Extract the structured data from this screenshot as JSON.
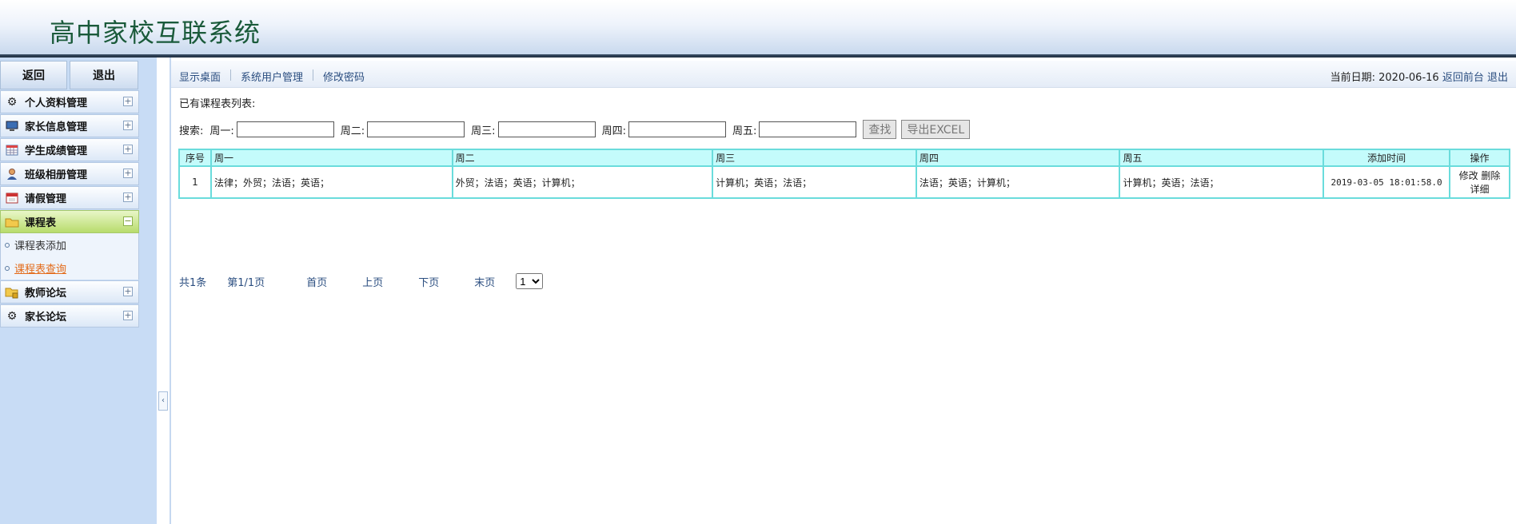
{
  "header": {
    "title": "高中家校互联系统"
  },
  "sidebar": {
    "back_label": "返回",
    "logout_label": "退出",
    "items": [
      {
        "label": "个人资料管理",
        "icon": "gear-icon",
        "toggle": "+"
      },
      {
        "label": "家长信息管理",
        "icon": "monitor-icon",
        "toggle": "+"
      },
      {
        "label": "学生成绩管理",
        "icon": "calendar-icon",
        "toggle": "+"
      },
      {
        "label": "班级相册管理",
        "icon": "user-icon",
        "toggle": "+"
      },
      {
        "label": "请假管理",
        "icon": "calendar-icon",
        "toggle": "+"
      },
      {
        "label": "课程表",
        "icon": "folder-icon",
        "toggle": "−"
      },
      {
        "label": "教师论坛",
        "icon": "folder-lock-icon",
        "toggle": "+"
      },
      {
        "label": "家长论坛",
        "icon": "gear-icon",
        "toggle": "+"
      }
    ],
    "sub_items": [
      {
        "label": "课程表添加"
      },
      {
        "label": "课程表查询"
      }
    ],
    "collapse_glyph": "‹"
  },
  "topnav": {
    "links": [
      "显示桌面",
      "系统用户管理",
      "修改密码"
    ],
    "date_label": "当前日期: ",
    "date_value": "2020-06-16",
    "back_front": "返回前台",
    "logout": "退出"
  },
  "main": {
    "list_title": "已有课程表列表:",
    "search": {
      "label": "搜索:",
      "fields": [
        {
          "label": "周一:",
          "value": ""
        },
        {
          "label": "周二:",
          "value": ""
        },
        {
          "label": "周三:",
          "value": ""
        },
        {
          "label": "周四:",
          "value": ""
        },
        {
          "label": "周五:",
          "value": ""
        }
      ],
      "find_button": "查找",
      "export_button": "导出EXCEL"
    },
    "table": {
      "headers": [
        "序号",
        "周一",
        "周二",
        "周三",
        "周四",
        "周五",
        "添加时间",
        "操作"
      ],
      "rows": [
        {
          "index": "1",
          "mon": "法律；外贸；法语；英语；",
          "tue": "外贸；法语；英语；计算机；",
          "wed": "计算机；英语；法语；",
          "thu": "法语；英语；计算机；",
          "fri": "计算机；英语；法语；",
          "time": "2019-03-05 18:01:58.0",
          "edit": "修改",
          "delete": "删除",
          "detail": "详细"
        }
      ]
    },
    "pager": {
      "total": "共1条",
      "page": "第1/1页",
      "first": "首页",
      "prev": "上页",
      "next": "下页",
      "last": "末页",
      "select_value": "1"
    }
  }
}
